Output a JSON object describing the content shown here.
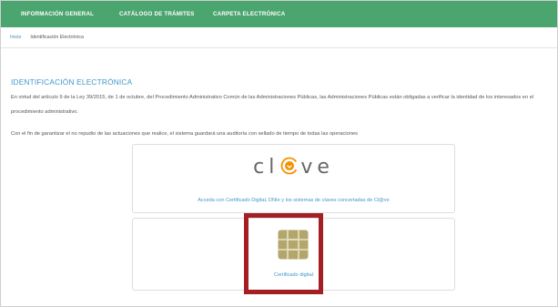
{
  "nav": {
    "items": [
      {
        "label": "INFORMACIÓN GENERAL"
      },
      {
        "label": "CATÁLOGO DE TRÁMITES"
      },
      {
        "label": "CARPETA ELECTRÓNICA"
      }
    ]
  },
  "breadcrumb": {
    "home": "Inicio",
    "current": "Identificación Electrónica"
  },
  "main": {
    "title": "IDENTIFICACIÓN ELECTRÓNICA",
    "paragraph1": "En virtud del artículo 9 de la Ley 39/2015, de 1 de octubre, del Procedimiento Administrativo Común de las Administraciones Públicas, las Administraciones Públicas están obligadas a verificar la identidad de los interesados en el procedimiento administrativo.",
    "paragraph2": "Con el fin de garantizar el no repudio de las actuaciones que realice, el sistema guardará una auditoría con sellado de tiempo de todas las operaciones"
  },
  "clave_card": {
    "logo_left": "cl",
    "logo_right": "ve",
    "link": "Acceda con Certificado Digital, DNIe y los sistemas de claves concertadas de Cl@ve",
    "icon": "clave-at-icon",
    "accent_color": "#f29100"
  },
  "cert_card": {
    "label": "Certificado digital",
    "icon": "smartcard-chip-icon",
    "chip_color": "#b3a66c"
  },
  "colors": {
    "nav_bg": "#4aa56f",
    "link": "#3f97c9",
    "highlight": "#a41f23"
  }
}
